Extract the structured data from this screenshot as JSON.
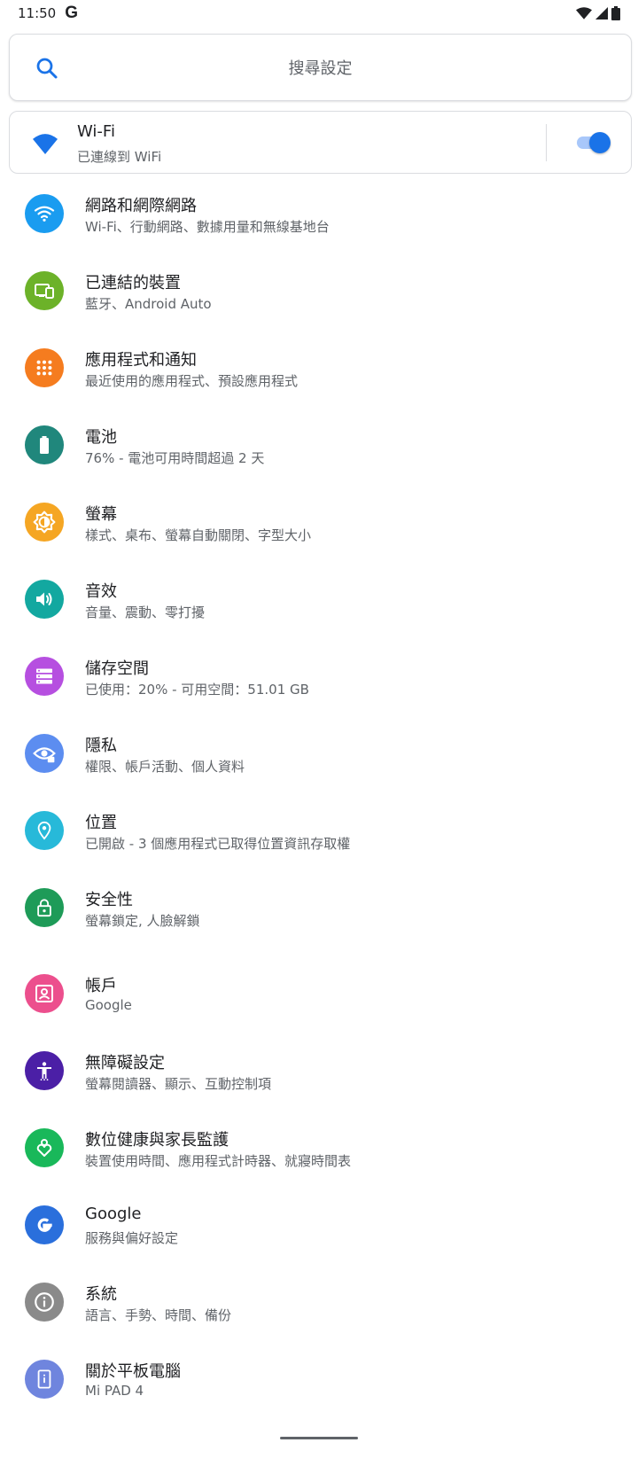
{
  "status_bar": {
    "time": "11:50",
    "notification_icon": "G"
  },
  "search": {
    "placeholder": "搜尋設定"
  },
  "wifi_card": {
    "title": "Wi-Fi",
    "subtitle": "已連線到 WiFi",
    "toggle_on": true
  },
  "items": [
    {
      "title": "網路和網際網路",
      "subtitle": "Wi-Fi、行動網路、數據用量和無線基地台",
      "icon": "wifi-icon",
      "color": "#1a9cf0"
    },
    {
      "title": "已連結的裝置",
      "subtitle": "藍牙、Android Auto",
      "icon": "devices-icon",
      "color": "#6cb229"
    },
    {
      "title": "應用程式和通知",
      "subtitle": "最近使用的應用程式、預設應用程式",
      "icon": "apps-grid-icon",
      "color": "#f57c1f"
    },
    {
      "title": "電池",
      "subtitle": "76% - 電池可用時間超過 2 天",
      "icon": "battery-icon",
      "color": "#20877c"
    },
    {
      "title": "螢幕",
      "subtitle": "樣式、桌布、螢幕自動關閉、字型大小",
      "icon": "brightness-icon",
      "color": "#f5a623"
    },
    {
      "title": "音效",
      "subtitle": "音量、震動、零打擾",
      "icon": "volume-icon",
      "color": "#13a8a0"
    },
    {
      "title": "儲存空間",
      "subtitle": "已使用：20% - 可用空間：51.01 GB",
      "icon": "storage-icon",
      "color": "#b64fe0"
    },
    {
      "title": "隱私",
      "subtitle": "權限、帳戶活動、個人資料",
      "icon": "privacy-eye-icon",
      "color": "#5c8df0"
    },
    {
      "title": "位置",
      "subtitle": "已開啟 - 3 個應用程式已取得位置資訊存取權",
      "icon": "location-pin-icon",
      "color": "#27b9d9"
    },
    {
      "title": "安全性",
      "subtitle": "螢幕鎖定, 人臉解鎖",
      "icon": "lock-icon",
      "color": "#1e9b58"
    },
    {
      "title": "帳戶",
      "subtitle": "Google",
      "icon": "account-icon",
      "color": "#ec4f8d"
    },
    {
      "title": "無障礙設定",
      "subtitle": "螢幕閱讀器、顯示、互動控制項",
      "icon": "accessibility-icon",
      "color": "#4b1fa6"
    },
    {
      "title": "數位健康與家長監護",
      "subtitle": "裝置使用時間、應用程式計時器、就寢時間表",
      "icon": "wellbeing-heart-icon",
      "color": "#19b85a"
    },
    {
      "title": "Google",
      "subtitle": "服務與偏好設定",
      "icon": "google-g-icon",
      "color": "#2a6fdc"
    },
    {
      "title": "系統",
      "subtitle": "語言、手勢、時間、備份",
      "icon": "info-icon",
      "color": "#8a8a8a"
    },
    {
      "title": "關於平板電腦",
      "subtitle": "Mi PAD 4",
      "icon": "tablet-info-icon",
      "color": "#6f85de"
    }
  ]
}
